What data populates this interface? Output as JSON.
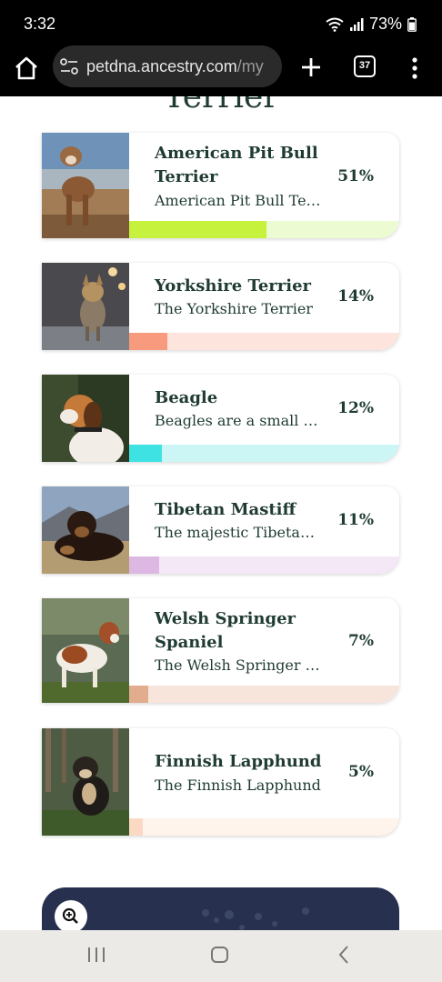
{
  "status_bar": {
    "time": "3:32",
    "battery": "73%",
    "icons": [
      "wifi-icon",
      "signal-icon",
      "battery-icon"
    ]
  },
  "browser": {
    "url_host": "petdna.ancestry.com",
    "url_rest": "/my",
    "tab_count": "37",
    "icons": [
      "home-icon",
      "site-settings-icon",
      "new-tab-icon",
      "tabs-icon",
      "menu-icon"
    ]
  },
  "section": {
    "title": "Terrier"
  },
  "breeds": [
    {
      "name": "American Pit Bull Terrier",
      "description": "American Pit Bull Terrier",
      "percent_label": "51%",
      "percent": 51,
      "colors": {
        "fill": "#c6f23e",
        "track": "#ecfbd2"
      }
    },
    {
      "name": "Yorkshire Terrier",
      "description": "The Yorkshire Terrier",
      "percent_label": "14%",
      "percent": 14,
      "colors": {
        "fill": "#f79a7e",
        "track": "#fde4dd"
      }
    },
    {
      "name": "Beagle",
      "description": "Beagles are a small to medium",
      "percent_label": "12%",
      "percent": 12,
      "colors": {
        "fill": "#3fe2e2",
        "track": "#ccf6f6"
      }
    },
    {
      "name": "Tibetan Mastiff",
      "description": "The majestic Tibetan Mastiff",
      "percent_label": "11%",
      "percent": 11,
      "colors": {
        "fill": "#ddb8e3",
        "track": "#f4e8f6"
      }
    },
    {
      "name": "Welsh Springer Spaniel",
      "description": "The Welsh Springer Spaniel",
      "percent_label": "7%",
      "percent": 7,
      "colors": {
        "fill": "#e2ac8f",
        "track": "#f7e5dc"
      }
    },
    {
      "name": "Finnish Lapphund",
      "description": "The Finnish Lapphund",
      "percent_label": "5%",
      "percent": 5,
      "colors": {
        "fill": "#fbd9c2",
        "track": "#fef4ec"
      }
    }
  ],
  "map_card": {
    "icons": [
      "zoom-in-icon"
    ],
    "color": "#27314f"
  },
  "nav": {
    "icons": [
      "recent-apps-icon",
      "home-button-icon",
      "back-icon"
    ]
  }
}
